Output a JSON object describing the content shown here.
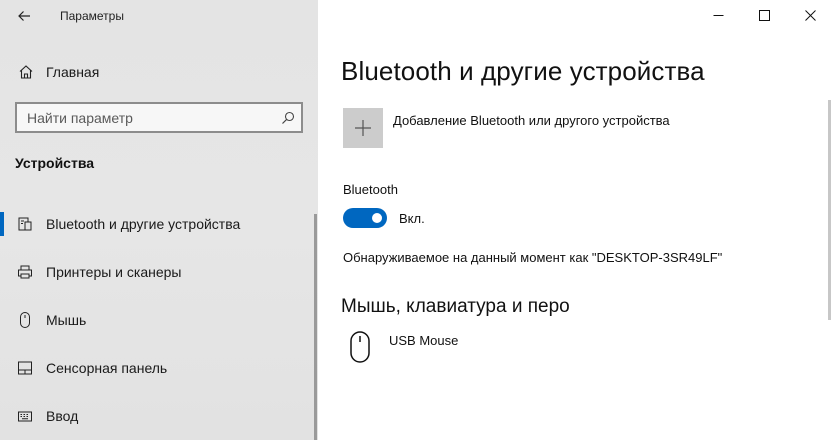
{
  "window": {
    "app_title": "Параметры",
    "back_icon": "arrow-left-icon",
    "controls": [
      "minimize-icon",
      "maximize-icon",
      "close-icon"
    ]
  },
  "sidebar": {
    "home_label": "Главная",
    "search_placeholder": "Найти параметр",
    "section_title": "Устройства",
    "items": [
      {
        "label": "Bluetooth и другие устройства",
        "icon": "bluetooth-devices-icon",
        "selected": true
      },
      {
        "label": "Принтеры и сканеры",
        "icon": "printer-icon",
        "selected": false
      },
      {
        "label": "Мышь",
        "icon": "mouse-icon",
        "selected": false
      },
      {
        "label": "Сенсорная панель",
        "icon": "touchpad-icon",
        "selected": false
      },
      {
        "label": "Ввод",
        "icon": "keyboard-icon",
        "selected": false
      }
    ]
  },
  "main": {
    "title": "Bluetooth и другие устройства",
    "add_device_label": "Добавление Bluetooth или другого устройства",
    "bluetooth_label": "Bluetooth",
    "bluetooth_state": "Вкл.",
    "bluetooth_on": true,
    "discoverable_text": "Обнаруживаемое на данный момент как \"DESKTOP-3SR49LF\"",
    "section_mouse_title": "Мышь, клавиатура и перо",
    "devices": [
      {
        "name": "USB Mouse",
        "icon": "mouse-icon"
      }
    ]
  },
  "colors": {
    "accent": "#0067c0",
    "sidebar_bg": "#e4e4e4",
    "tile_bg": "#cccccc"
  }
}
